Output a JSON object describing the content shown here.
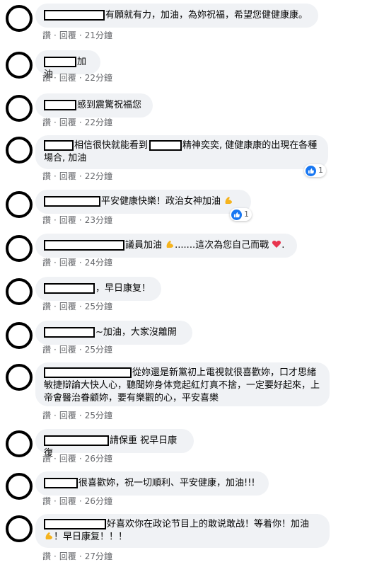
{
  "actions": {
    "like": "讚",
    "reply": "回覆",
    "sep": "·"
  },
  "comments": [
    {
      "text": "有願就有力，加油，為妳祝福，希望您健健康康。",
      "time": "21分鐘"
    },
    {
      "text": "加油",
      "time": "22分鐘"
    },
    {
      "text": "感到震驚祝福您",
      "time": "22分鐘"
    },
    {
      "text_a": "相信很快就能看到",
      "text_b": "精神奕奕, 健健康康的出現在各種場合, 加油",
      "time": "22分鐘",
      "reactions": "1"
    },
    {
      "text": "平安健康快樂！政治女神加油",
      "time": "23分鐘",
      "reactions": "1"
    },
    {
      "text_a": "議員加油",
      "text_b": ".......這次為您自己而戰",
      "text_c": ".",
      "time": "24分鐘"
    },
    {
      "text": "，早日康复！",
      "time": "25分鐘"
    },
    {
      "text": "~加油，大家沒離開",
      "time": "25分鐘"
    },
    {
      "text": "從妳還是新黨初上電視就很喜歡妳，口才思緒敏捷辯論大快人心，聽聞妳身体竞起紅灯真不捨，一定要好起來，上帝會醫治眷顧妳，要有樂觀的心，平安喜樂",
      "time": "25分鐘"
    },
    {
      "text": "請保重 祝早日康復",
      "time": "26分鐘"
    },
    {
      "text": "很喜歡妳，祝一切順利、平安健康，加油!!!",
      "time": "26分鐘"
    },
    {
      "text_a": "好喜欢你在政论节目上的敢说敢战！等着你！加油",
      "text_b": "！早日康复！！！",
      "time": "27分鐘"
    }
  ]
}
